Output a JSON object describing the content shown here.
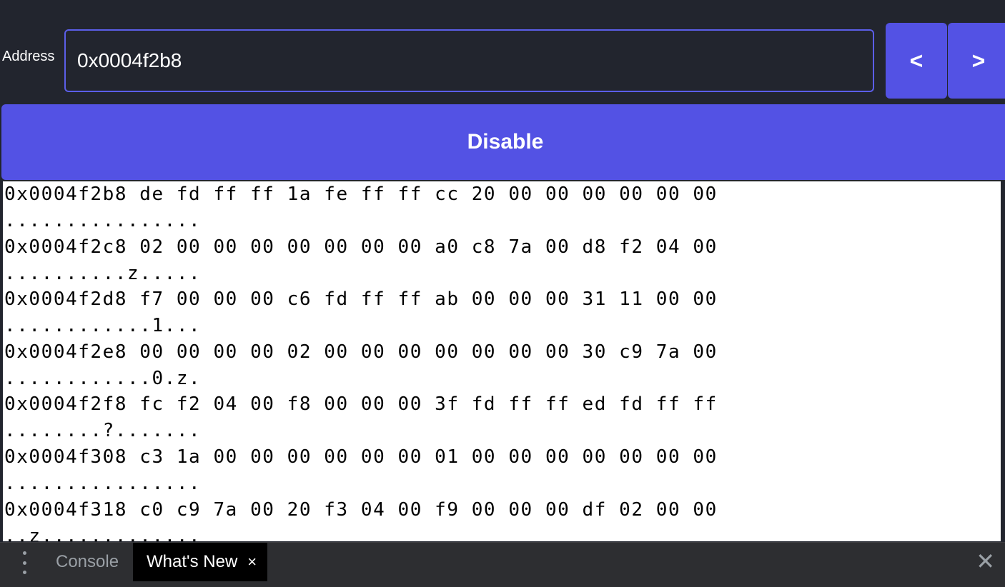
{
  "address": {
    "label": "Address",
    "value": "0x0004f2b8"
  },
  "nav": {
    "prev_label": "<",
    "next_label": ">"
  },
  "toggle": {
    "label": "Disable"
  },
  "hexdump": {
    "rows": [
      {
        "hex": "0x0004f2b8 de fd ff ff 1a fe ff ff cc 20 00 00 00 00 00 00",
        "ascii": "................"
      },
      {
        "hex": "0x0004f2c8 02 00 00 00 00 00 00 00 a0 c8 7a 00 d8 f2 04 00",
        "ascii": "..........z....."
      },
      {
        "hex": "0x0004f2d8 f7 00 00 00 c6 fd ff ff ab 00 00 00 31 11 00 00",
        "ascii": "............1..."
      },
      {
        "hex": "0x0004f2e8 00 00 00 00 02 00 00 00 00 00 00 00 30 c9 7a 00",
        "ascii": "............0.z."
      },
      {
        "hex": "0x0004f2f8 fc f2 04 00 f8 00 00 00 3f fd ff ff ed fd ff ff",
        "ascii": "........?......."
      },
      {
        "hex": "0x0004f308 c3 1a 00 00 00 00 00 00 01 00 00 00 00 00 00 00",
        "ascii": "................"
      },
      {
        "hex": "0x0004f318 c0 c9 7a 00 20 f3 04 00 f9 00 00 00 df 02 00 00",
        "ascii": "..z............."
      }
    ]
  },
  "drawer": {
    "menu_icon": "kebab-menu-icon",
    "tabs": [
      {
        "label": "Console",
        "active": false
      },
      {
        "label": "What's New",
        "active": true,
        "close": "×"
      }
    ],
    "close_label": "✕"
  }
}
